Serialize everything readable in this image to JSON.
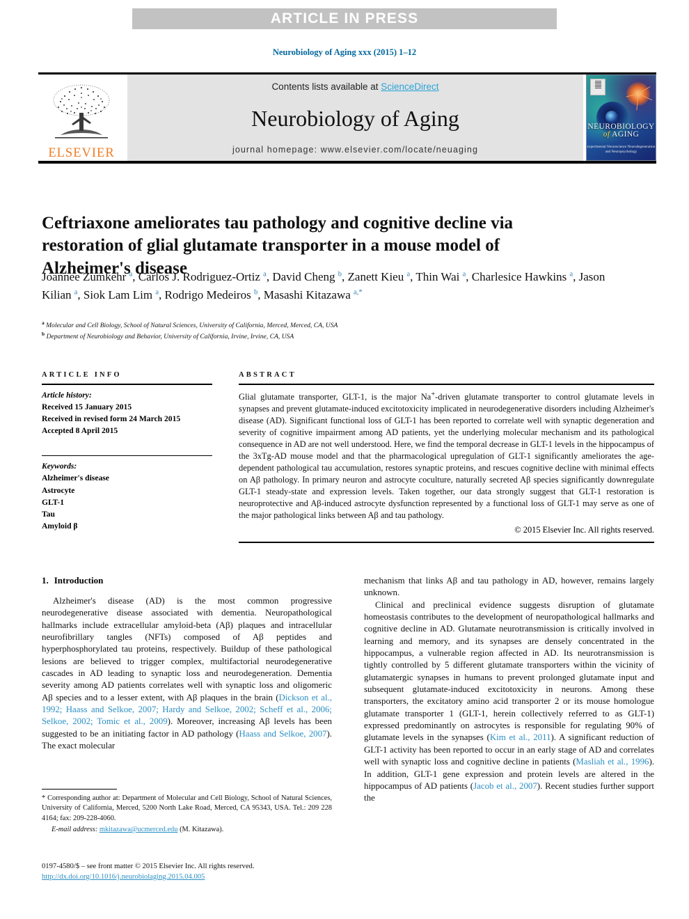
{
  "banner": {
    "text": "ARTICLE IN PRESS"
  },
  "running_head": "Neurobiology of Aging xxx (2015) 1–12",
  "masthead": {
    "contents_prefix": "Contents lists available at ",
    "sciencedirect": "ScienceDirect",
    "journal_title": "Neurobiology of Aging",
    "homepage": "journal homepage: www.elsevier.com/locate/neuaging",
    "publisher_logo_text": "ELSEVIER",
    "cover": {
      "line1": "NEUROBIOLOGY",
      "line2_italic": "of",
      "line2_rest": " AGING",
      "subtitle": "experimental Neuroscience\nNeurodegeneration and Neuropsychology"
    },
    "colors": {
      "band_gray": "#c2c2c2",
      "masthead_gray": "#e3e3e3",
      "link_blue": "#2aa4d8",
      "elsevier_orange": "#ef7c22",
      "running_head_blue": "#00679c"
    }
  },
  "article": {
    "title": "Ceftriaxone ameliorates tau pathology and cognitive decline via restoration of glial glutamate transporter in a mouse model of Alzheimer's disease",
    "authors_html": "Joannee Zumkehr <sup>a</sup>, Carlos J. Rodriguez-Ortiz <sup>a</sup>, David Cheng <sup>b</sup>, Zanett Kieu <sup>a</sup>, Thin Wai <sup>a</sup>, Charlesice Hawkins <sup>a</sup>, Jason Kilian <sup>a</sup>, Siok Lam Lim <sup>a</sup>, Rodrigo Medeiros <sup>b</sup>, Masashi Kitazawa <sup>a,*</sup>",
    "affiliations": [
      {
        "mark": "a",
        "text": "Molecular and Cell Biology, School of Natural Sciences, University of California, Merced, Merced, CA, USA"
      },
      {
        "mark": "b",
        "text": "Department of Neurobiology and Behavior, University of California, Irvine, Irvine, CA, USA"
      }
    ]
  },
  "article_info": {
    "heading": "ARTICLE INFO",
    "history_label": "Article history:",
    "history": [
      "Received 15 January 2015",
      "Received in revised form 24 March 2015",
      "Accepted 8 April 2015"
    ],
    "keywords_label": "Keywords:",
    "keywords": [
      "Alzheimer's disease",
      "Astrocyte",
      "GLT-1",
      "Tau",
      "Amyloid β"
    ]
  },
  "abstract": {
    "heading": "ABSTRACT",
    "body_html": "Glial glutamate transporter, GLT-1, is the major Na<sup>+</sup>-driven glutamate transporter to control glutamate levels in synapses and prevent glutamate-induced excitotoxicity implicated in neurodegenerative disorders including Alzheimer's disease (AD). Significant functional loss of GLT-1 has been reported to correlate well with synaptic degeneration and severity of cognitive impairment among AD patients, yet the underlying molecular mechanism and its pathological consequence in AD are not well understood. Here, we find the temporal decrease in GLT-1 levels in the hippocampus of the 3xTg-AD mouse model and that the pharmacological upregulation of GLT-1 significantly ameliorates the age-dependent pathological tau accumulation, restores synaptic proteins, and rescues cognitive decline with minimal effects on Aβ pathology. In primary neuron and astrocyte coculture, naturally secreted Aβ species significantly downregulate GLT-1 steady-state and expression levels. Taken together, our data strongly suggest that GLT-1 restoration is neuroprotective and Aβ-induced astrocyte dysfunction represented by a functional loss of GLT-1 may serve as one of the major pathological links between Aβ and tau pathology.",
    "rights": "© 2015 Elsevier Inc. All rights reserved."
  },
  "body": {
    "section_number": "1.",
    "section_title": "Introduction",
    "left_paragraphs_html": [
      "Alzheimer's disease (AD) is the most common progressive neurodegenerative disease associated with dementia. Neuropathological hallmarks include extracellular amyloid-beta (Aβ) plaques and intracellular neurofibrillary tangles (NFTs) composed of Aβ peptides and hyperphosphorylated tau proteins, respectively. Buildup of these pathological lesions are believed to trigger complex, multifactorial neurodegenerative cascades in AD leading to synaptic loss and neurodegeneration. Dementia severity among AD patients correlates well with synaptic loss and oligomeric Aβ species and to a lesser extent, with Aβ plaques in the brain (<span class=\"cit\">Dickson et al., 1992; Haass and Selkoe, 2007; Hardy and Selkoe, 2002; Scheff et al., 2006; Selkoe, 2002; Tomic et al., 2009</span>). Moreover, increasing Aβ levels has been suggested to be an initiating factor in AD pathology (<span class=\"cit\">Haass and Selkoe, 2007</span>). The exact molecular"
    ],
    "right_paragraphs_html": [
      "mechanism that links Aβ and tau pathology in AD, however, remains largely unknown.",
      "Clinical and preclinical evidence suggests disruption of glutamate homeostasis contributes to the development of neuropathological hallmarks and cognitive decline in AD. Glutamate neurotransmission is critically involved in learning and memory, and its synapses are densely concentrated in the hippocampus, a vulnerable region affected in AD. Its neurotransmission is tightly controlled by 5 different glutamate transporters within the vicinity of glutamatergic synapses in humans to prevent prolonged glutamate input and subsequent glutamate-induced excitotoxicity in neurons. Among these transporters, the excitatory amino acid transporter 2 or its mouse homologue glutamate transporter 1 (GLT-1, herein collectively referred to as GLT-1) expressed predominantly on astrocytes is responsible for regulating 90% of glutamate levels in the synapses (<span class=\"cit\">Kim et al., 2011</span>). A significant reduction of GLT-1 activity has been reported to occur in an early stage of AD and correlates well with synaptic loss and cognitive decline in patients (<span class=\"cit\">Masliah et al., 1996</span>). In addition, GLT-1 gene expression and protein levels are altered in the hippocampus of AD patients (<span class=\"cit\">Jacob et al., 2007</span>). Recent studies further support the"
    ]
  },
  "footnotes": {
    "corresponding_html": "<span class=\"star\">*</span> Corresponding author at: Department of Molecular and Cell Biology, School of Natural Sciences, University of California, Merced, 5200 North Lake Road, Merced, CA 95343, USA. Tel.: 209 228 4164; fax: 209-228-4060.",
    "email_label": "E-mail address:",
    "email": "mkitazawa@ucmerced.edu",
    "email_suffix": "(M. Kitazawa)."
  },
  "imprint": {
    "line1": "0197-4580/$ – see front matter © 2015 Elsevier Inc. All rights reserved.",
    "doi": "http://dx.doi.org/10.1016/j.neurobiolaging.2015.04.005"
  }
}
